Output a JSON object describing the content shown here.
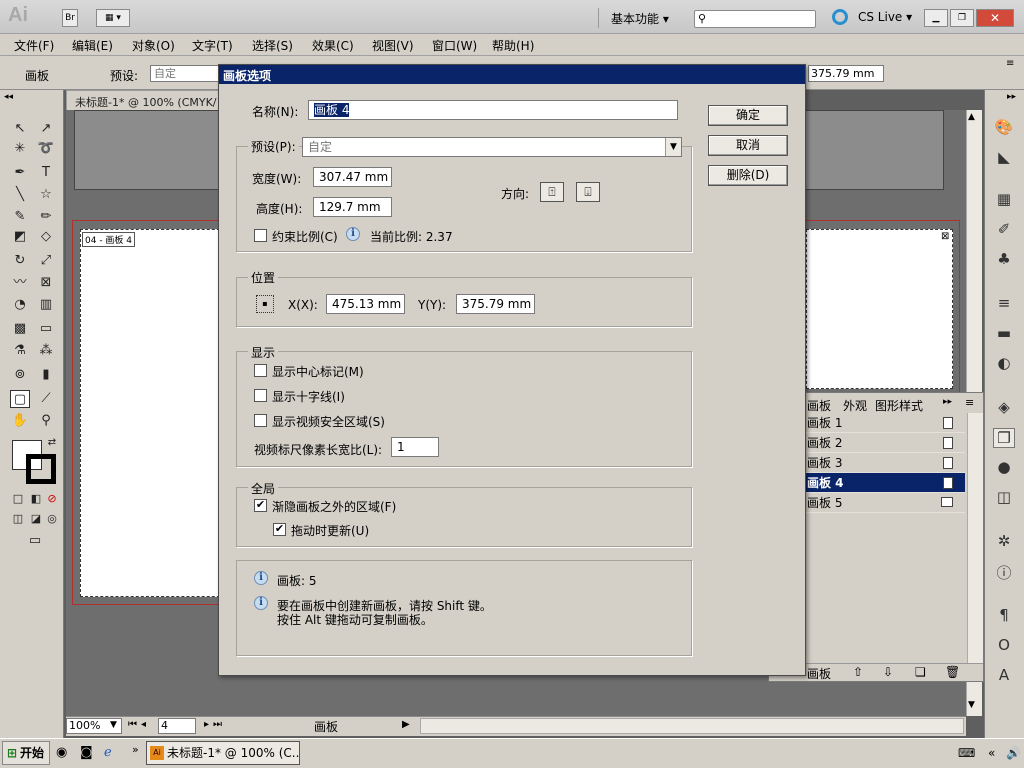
{
  "app": {
    "logo": "Ai",
    "bridge_label": "Br",
    "workspace": "基本功能",
    "cs_live": "CS Live"
  },
  "menu": [
    "文件(F)",
    "编辑(E)",
    "对象(O)",
    "文字(T)",
    "选择(S)",
    "效果(C)",
    "视图(V)",
    "窗口(W)",
    "帮助(H)"
  ],
  "control_bar": {
    "panel_label": "画板",
    "preset_label": "预设:",
    "preset_value": "自定",
    "y_value": "375.79 mm"
  },
  "document": {
    "tab_title": "未标题-1* @ 100% (CMYK/",
    "artboard_label": "04 - 画板 4"
  },
  "dialog": {
    "title": "画板选项",
    "name_label": "名称(N):",
    "name_value": "画板 4",
    "preset_label": "预设(P):",
    "preset_value": "自定",
    "width_label": "宽度(W):",
    "width_value": "307.47 mm",
    "height_label": "高度(H):",
    "height_value": "129.7 mm",
    "orientation_label": "方向:",
    "constrain_label": "约束比例(C)",
    "ratio_label": "当前比例: 2.37",
    "position_title": "位置",
    "x_label": "X(X):",
    "x_value": "475.13 mm",
    "y_label": "Y(Y):",
    "y_value": "375.79 mm",
    "display_title": "显示",
    "show_center_label": "显示中心标记(M)",
    "show_cross_label": "显示十字线(I)",
    "show_safe_label": "显示视频安全区域(S)",
    "pixel_ratio_label": "视频标尺像素长宽比(L):",
    "pixel_ratio_value": "1",
    "global_title": "全局",
    "fade_label": "渐隐画板之外的区域(F)",
    "update_label": "拖动时更新(U)",
    "info_count": "画板: 5",
    "info_line1": "要在画板中创建新画板，请按 Shift 键。",
    "info_line2": "按住 Alt 键拖动可复制画板。",
    "ok_label": "确定",
    "cancel_label": "取消",
    "delete_label": "删除(D)",
    "constrain_checked": false,
    "show_center_checked": false,
    "show_cross_checked": false,
    "show_safe_checked": false,
    "fade_checked": true,
    "update_checked": true
  },
  "artboard_panel": {
    "tabs": [
      "画板",
      "外观",
      "图形样式"
    ],
    "items": [
      "画板 1",
      "画板 2",
      "画板 3",
      "画板 4",
      "画板 5"
    ],
    "selected_index": 3,
    "footer_label": "画板"
  },
  "status": {
    "zoom": "100%",
    "page": "4",
    "label": "画板"
  },
  "taskbar": {
    "start": "开始",
    "task_item": "未标题-1* @ 100% (C..."
  },
  "colors": {
    "dialog_title_bg": "#0a246a",
    "selection_bg": "#0a246a",
    "panel_bg": "#d4d0c8",
    "canvas_bg": "#6e6e6e",
    "artboard_border": "#b03030"
  }
}
